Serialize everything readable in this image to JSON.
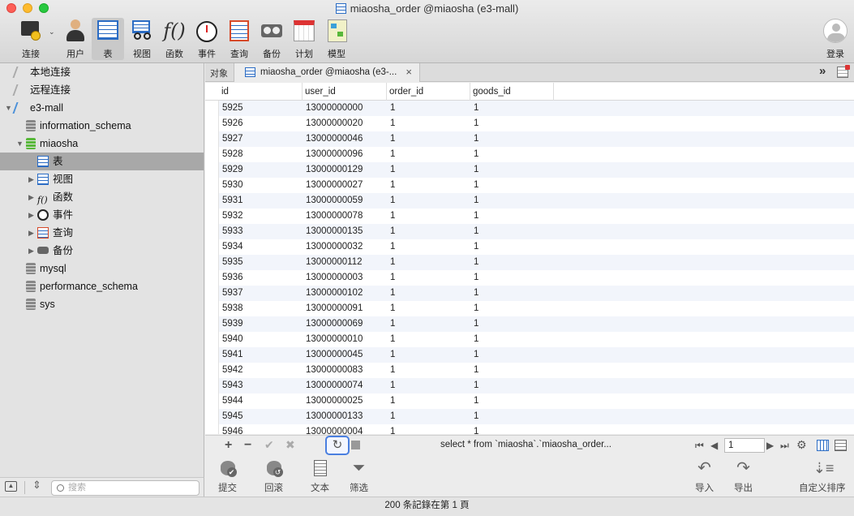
{
  "window": {
    "title": "miaosha_order @miaosha (e3-mall)"
  },
  "toolbar": {
    "items": [
      {
        "label": "连接",
        "icon": "connection-icon"
      },
      {
        "label": "用户",
        "icon": "user-icon"
      },
      {
        "label": "表",
        "icon": "table-icon",
        "active": true
      },
      {
        "label": "视图",
        "icon": "view-icon"
      },
      {
        "label": "函数",
        "icon": "function-icon"
      },
      {
        "label": "事件",
        "icon": "event-icon"
      },
      {
        "label": "查询",
        "icon": "query-icon"
      },
      {
        "label": "备份",
        "icon": "backup-icon"
      },
      {
        "label": "计划",
        "icon": "schedule-icon"
      },
      {
        "label": "模型",
        "icon": "model-icon"
      }
    ],
    "login_label": "登录"
  },
  "sidebar": {
    "nodes": [
      {
        "label": "本地连接"
      },
      {
        "label": "远程连接"
      },
      {
        "label": "e3-mall"
      },
      {
        "label": "information_schema"
      },
      {
        "label": "miaosha"
      },
      {
        "label": "表"
      },
      {
        "label": "视图"
      },
      {
        "label": "函数"
      },
      {
        "label": "事件"
      },
      {
        "label": "查询"
      },
      {
        "label": "备份"
      },
      {
        "label": "mysql"
      },
      {
        "label": "performance_schema"
      },
      {
        "label": "sys"
      }
    ],
    "search_placeholder": "搜索"
  },
  "tabs": {
    "objects_label": "对象",
    "active_tab": "miaosha_order @miaosha (e3-..."
  },
  "grid": {
    "columns": [
      "id",
      "user_id",
      "order_id",
      "goods_id"
    ],
    "rows": [
      [
        "5925",
        "13000000000",
        "1",
        "1"
      ],
      [
        "5926",
        "13000000020",
        "1",
        "1"
      ],
      [
        "5927",
        "13000000046",
        "1",
        "1"
      ],
      [
        "5928",
        "13000000096",
        "1",
        "1"
      ],
      [
        "5929",
        "13000000129",
        "1",
        "1"
      ],
      [
        "5930",
        "13000000027",
        "1",
        "1"
      ],
      [
        "5931",
        "13000000059",
        "1",
        "1"
      ],
      [
        "5932",
        "13000000078",
        "1",
        "1"
      ],
      [
        "5933",
        "13000000135",
        "1",
        "1"
      ],
      [
        "5934",
        "13000000032",
        "1",
        "1"
      ],
      [
        "5935",
        "13000000112",
        "1",
        "1"
      ],
      [
        "5936",
        "13000000003",
        "1",
        "1"
      ],
      [
        "5937",
        "13000000102",
        "1",
        "1"
      ],
      [
        "5938",
        "13000000091",
        "1",
        "1"
      ],
      [
        "5939",
        "13000000069",
        "1",
        "1"
      ],
      [
        "5940",
        "13000000010",
        "1",
        "1"
      ],
      [
        "5941",
        "13000000045",
        "1",
        "1"
      ],
      [
        "5942",
        "13000000083",
        "1",
        "1"
      ],
      [
        "5943",
        "13000000074",
        "1",
        "1"
      ],
      [
        "5944",
        "13000000025",
        "1",
        "1"
      ],
      [
        "5945",
        "13000000133",
        "1",
        "1"
      ],
      [
        "5946",
        "13000000004",
        "1",
        "1"
      ]
    ]
  },
  "editbar": {
    "add": "+",
    "remove": "−",
    "apply": "✔",
    "discard": "✖",
    "refresh": "↻",
    "sql": "select * from `miaosha`.`miaosha_order...",
    "page": "1"
  },
  "actions": {
    "commit": "提交",
    "rollback": "回滚",
    "text": "文本",
    "filter": "筛选",
    "import": "导入",
    "export": "导出",
    "custom_sort": "自定义排序"
  },
  "status": {
    "text": "200 条記錄在第 1 頁"
  }
}
